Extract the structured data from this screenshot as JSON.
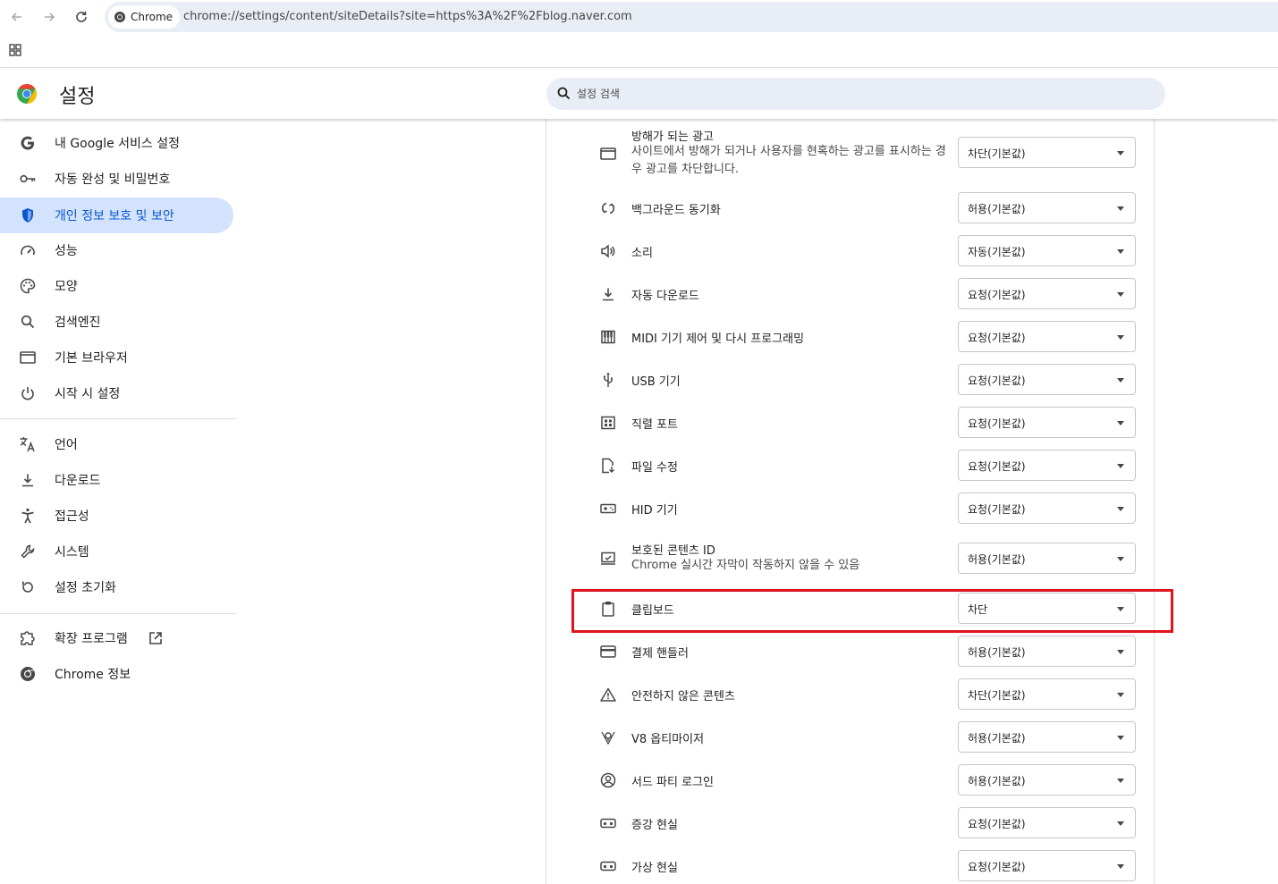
{
  "browser": {
    "chip_label": "Chrome",
    "url": "chrome://settings/content/siteDetails?site=https%3A%2F%2Fblog.naver.com"
  },
  "header": {
    "title": "설정",
    "search_placeholder": "설정 검색"
  },
  "sidebar": {
    "items": [
      {
        "label": "내 Google 서비스 설정",
        "icon": "google-g-icon"
      },
      {
        "label": "자동 완성 및 비밀번호",
        "icon": "key-icon"
      },
      {
        "label": "개인 정보 보호 및 보안",
        "icon": "shield-icon",
        "active": true
      },
      {
        "label": "성능",
        "icon": "speedometer-icon"
      },
      {
        "label": "모양",
        "icon": "palette-icon"
      },
      {
        "label": "검색엔진",
        "icon": "search-icon"
      },
      {
        "label": "기본 브라우저",
        "icon": "browser-window-icon"
      },
      {
        "label": "시작 시 설정",
        "icon": "power-icon"
      },
      {
        "label": "언어",
        "icon": "translate-icon"
      },
      {
        "label": "다운로드",
        "icon": "download-icon"
      },
      {
        "label": "접근성",
        "icon": "accessibility-icon"
      },
      {
        "label": "시스템",
        "icon": "wrench-icon"
      },
      {
        "label": "설정 초기화",
        "icon": "reset-icon"
      },
      {
        "label": "확장 프로그램",
        "icon": "extension-icon"
      },
      {
        "label": "Chrome 정보",
        "icon": "chrome-icon"
      }
    ]
  },
  "permissions": [
    {
      "title": "방해가 되는 광고",
      "subtitle": "사이트에서 방해가 되거나 사용자를 현혹하는 광고를 표시하는 경우 광고를 차단합니다.",
      "value": "차단(기본값)",
      "icon": "ads-icon"
    },
    {
      "title": "백그라운드 동기화",
      "value": "허용(기본값)",
      "icon": "sync-icon"
    },
    {
      "title": "소리",
      "value": "자동(기본값)",
      "icon": "speaker-icon"
    },
    {
      "title": "자동 다운로드",
      "value": "요청(기본값)",
      "icon": "download-icon"
    },
    {
      "title": "MIDI 기기 제어 및 다시 프로그래밍",
      "value": "요청(기본값)",
      "icon": "piano-icon"
    },
    {
      "title": "USB 기기",
      "value": "요청(기본값)",
      "icon": "usb-icon"
    },
    {
      "title": "직렬 포트",
      "value": "요청(기본값)",
      "icon": "serial-port-icon"
    },
    {
      "title": "파일 수정",
      "value": "요청(기본값)",
      "icon": "file-edit-icon"
    },
    {
      "title": "HID 기기",
      "value": "요청(기본값)",
      "icon": "gamepad-icon"
    },
    {
      "title": "보호된 콘텐츠 ID",
      "subtitle": "Chrome 실시간 자막이 작동하지 않을 수 있음",
      "value": "허용(기본값)",
      "icon": "protected-content-icon"
    },
    {
      "title": "클립보드",
      "value": "차단",
      "icon": "clipboard-icon"
    },
    {
      "title": "결제 핸들러",
      "value": "허용(기본값)",
      "icon": "credit-card-icon"
    },
    {
      "title": "안전하지 않은 콘텐츠",
      "value": "차단(기본값)",
      "icon": "warning-icon"
    },
    {
      "title": "V8 옵티마이저",
      "value": "허용(기본값)",
      "icon": "v8-icon"
    },
    {
      "title": "서드 파티 로그인",
      "value": "허용(기본값)",
      "icon": "account-circle-icon"
    },
    {
      "title": "증강 현실",
      "value": "요청(기본값)",
      "icon": "ar-headset-icon"
    },
    {
      "title": "가상 현실",
      "value": "요청(기본값)",
      "icon": "vr-headset-icon"
    }
  ],
  "highlight_color": "#e0141e",
  "accent_color": "#0b57d0"
}
